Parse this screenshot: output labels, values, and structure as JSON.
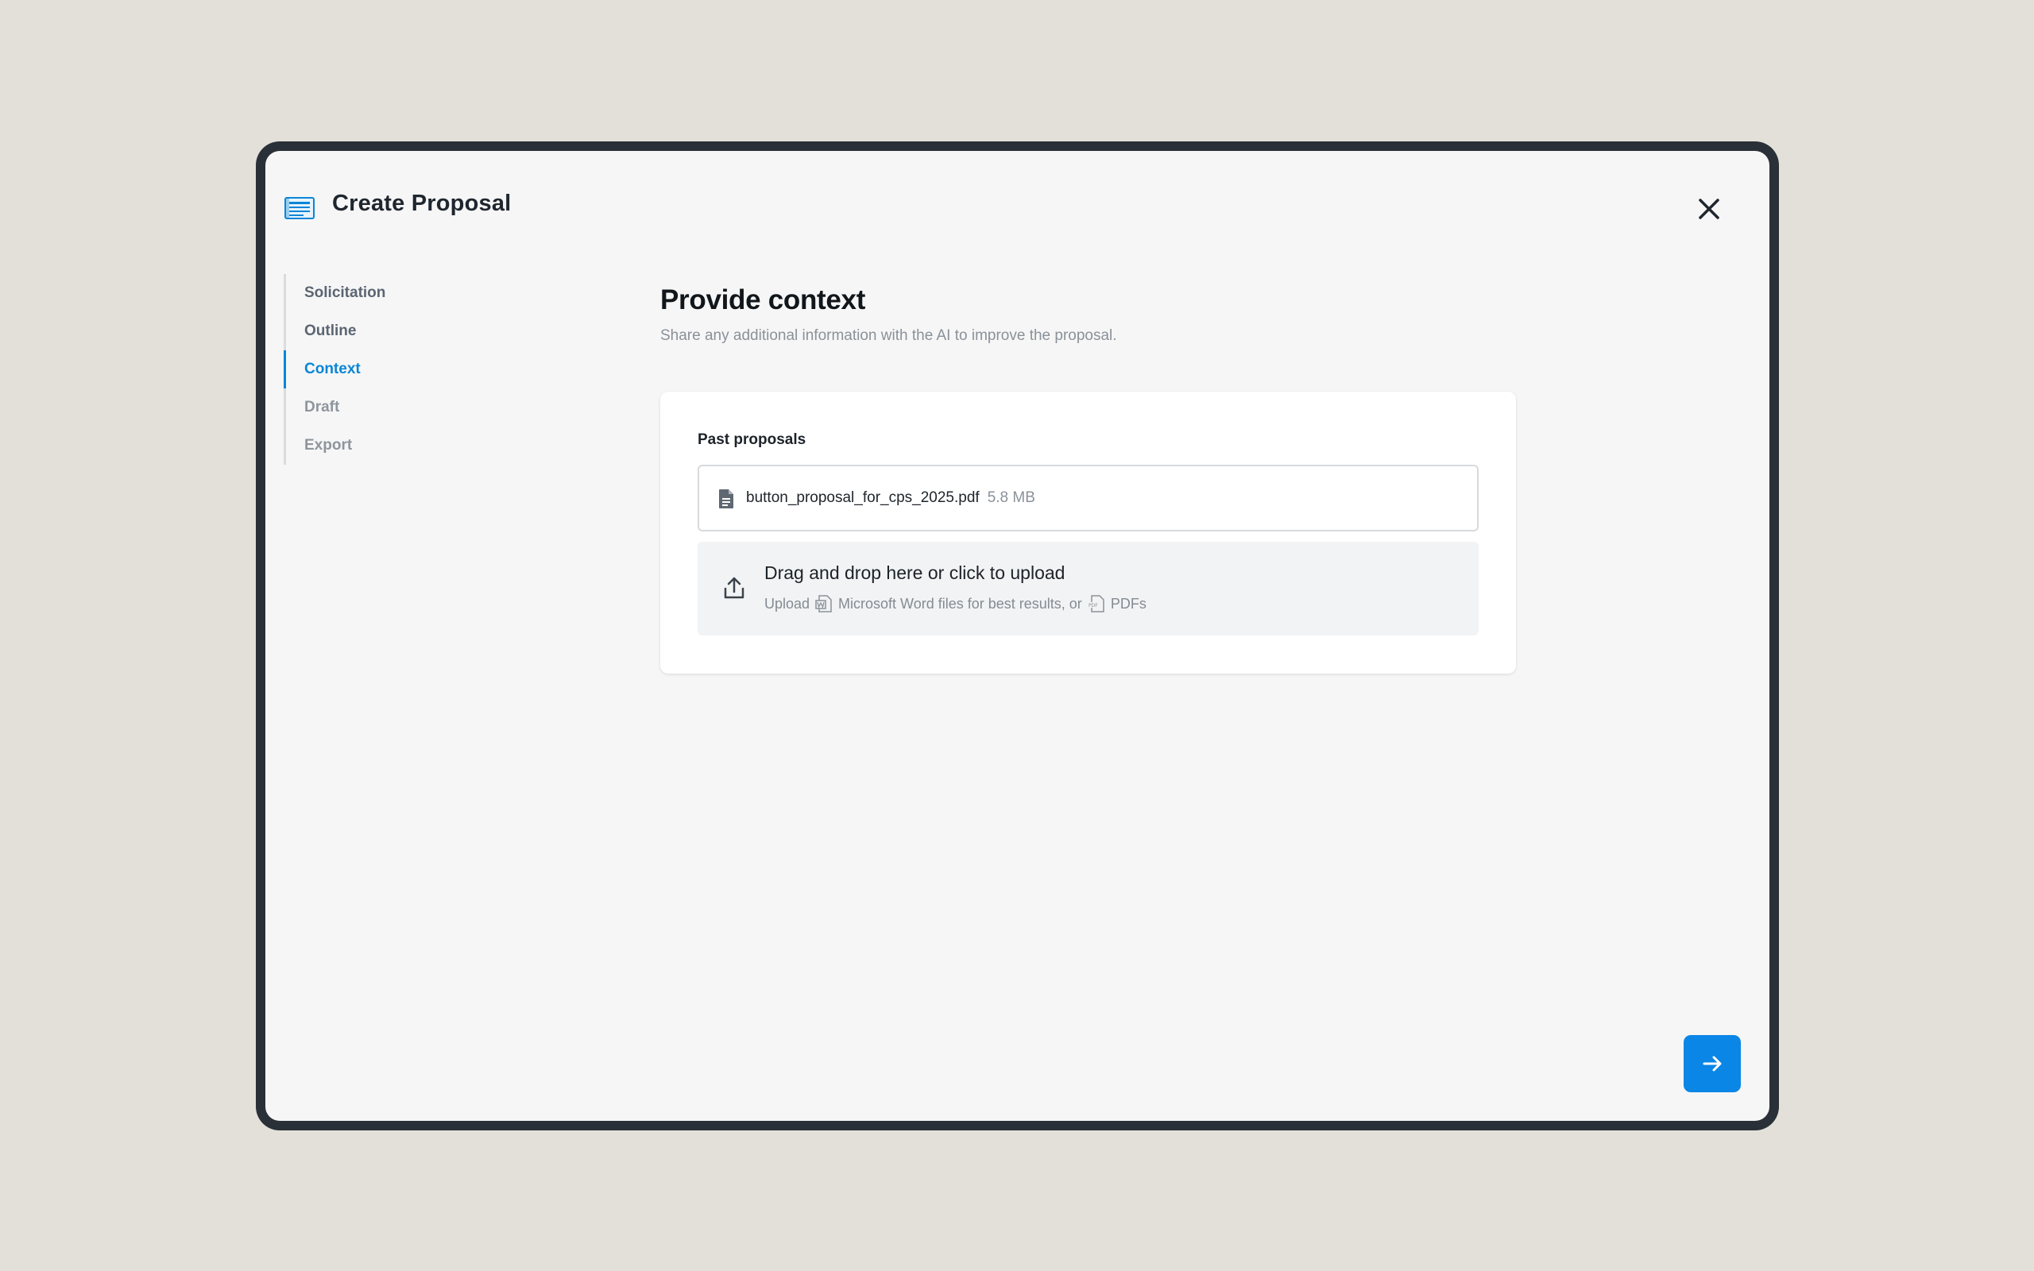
{
  "app": {
    "title": "Create Proposal",
    "accent_color": "#0a86e6",
    "header_icon": "proposal-document-icon"
  },
  "steps": [
    {
      "label": "Solicitation",
      "state": "completed"
    },
    {
      "label": "Outline",
      "state": "completed"
    },
    {
      "label": "Context",
      "state": "active"
    },
    {
      "label": "Draft",
      "state": "upcoming"
    },
    {
      "label": "Export",
      "state": "upcoming"
    }
  ],
  "main": {
    "title": "Provide context",
    "subtitle": "Share any additional information with the AI to improve the proposal."
  },
  "card": {
    "section_label": "Past proposals",
    "files": [
      {
        "name": "button_proposal_for_cps_2025.pdf",
        "size": "5.8 MB",
        "icon": "document-icon"
      }
    ],
    "dropzone": {
      "title": "Drag and drop here or click to upload",
      "sub_prefix": "Upload",
      "sub_word": "Microsoft Word files for best results, or",
      "sub_pdf": "PDFs",
      "icon": "upload-icon"
    }
  },
  "actions": {
    "close_icon": "close-icon",
    "next_icon": "arrow-right-icon"
  }
}
